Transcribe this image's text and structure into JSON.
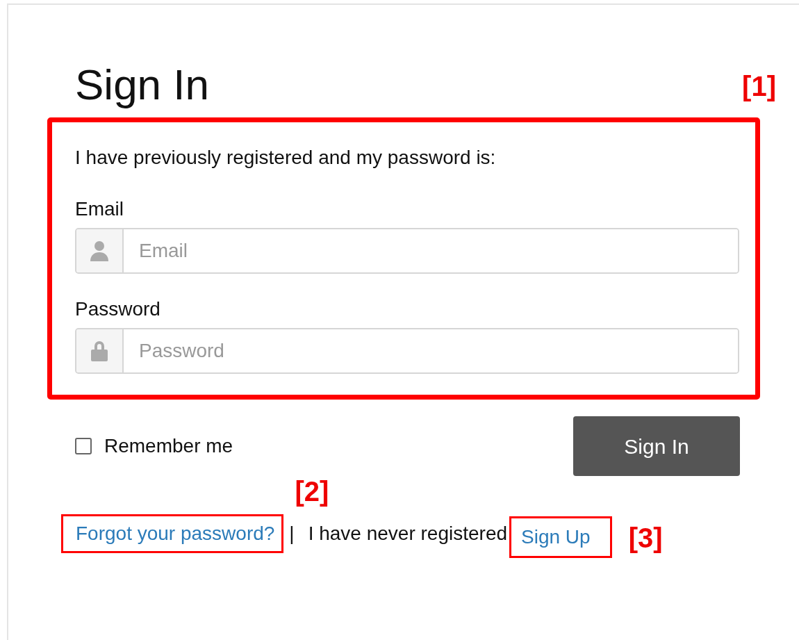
{
  "title": "Sign In",
  "intro": "I have previously registered and my password is:",
  "fields": [
    {
      "label": "Email",
      "placeholder": "Email",
      "kind": "user"
    },
    {
      "label": "Password",
      "placeholder": "Password",
      "kind": "lock"
    }
  ],
  "remember": {
    "label": "Remember me",
    "checked": false
  },
  "submit": "Sign In",
  "footer": {
    "forgot": "Forgot your password?",
    "separator": "|",
    "never": "I have never registered",
    "signup": "Sign Up"
  },
  "annotations": [
    {
      "label": "[1]"
    },
    {
      "label": "[2]"
    },
    {
      "label": "[3]"
    }
  ]
}
